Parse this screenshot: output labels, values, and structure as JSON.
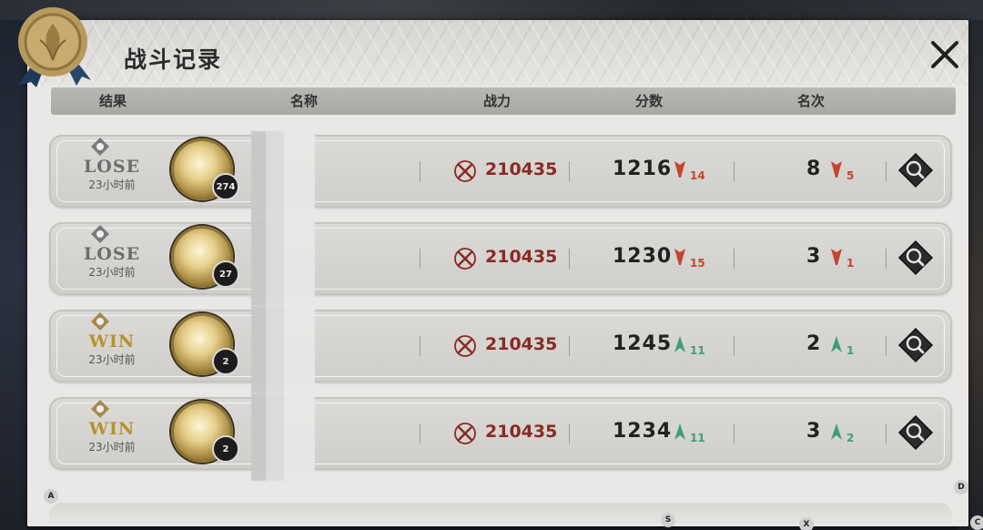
{
  "window": {
    "title": "战斗记录"
  },
  "columns": {
    "result": "结果",
    "name": "名称",
    "power": "战力",
    "score": "分数",
    "rank": "名次"
  },
  "colors": {
    "loss_red": "#c4452e",
    "gain_green": "#3e9c7c",
    "power_red": "#8a2a22",
    "win_gold": "#b8912b",
    "lose_grey": "#6e6e6e"
  },
  "records": [
    {
      "result": "LOSE",
      "time": "23小时前",
      "level": "274",
      "power": "210435",
      "score": "1216",
      "score_delta": "14",
      "score_trend": "down",
      "rank": "8",
      "rank_delta": "5",
      "rank_trend": "down"
    },
    {
      "result": "LOSE",
      "time": "23小时前",
      "level": "27",
      "power": "210435",
      "score": "1230",
      "score_delta": "15",
      "score_trend": "down",
      "rank": "3",
      "rank_delta": "1",
      "rank_trend": "down"
    },
    {
      "result": "WIN",
      "time": "23小时前",
      "level": "2",
      "power": "210435",
      "score": "1245",
      "score_delta": "11",
      "score_trend": "up",
      "rank": "2",
      "rank_delta": "1",
      "rank_trend": "up"
    },
    {
      "result": "WIN",
      "time": "23小时前",
      "level": "2",
      "power": "210435",
      "score": "1234",
      "score_delta": "11",
      "score_trend": "up",
      "rank": "3",
      "rank_delta": "2",
      "rank_trend": "up"
    }
  ],
  "hotkeys": {
    "a": "A",
    "d": "D",
    "s": "S",
    "x": "X",
    "c": "C"
  },
  "icons": {
    "close": "close-x-icon",
    "seal": "wax-seal-icon",
    "power": "crossed-swords-icon",
    "detail": "magnifier-detail-icon"
  }
}
